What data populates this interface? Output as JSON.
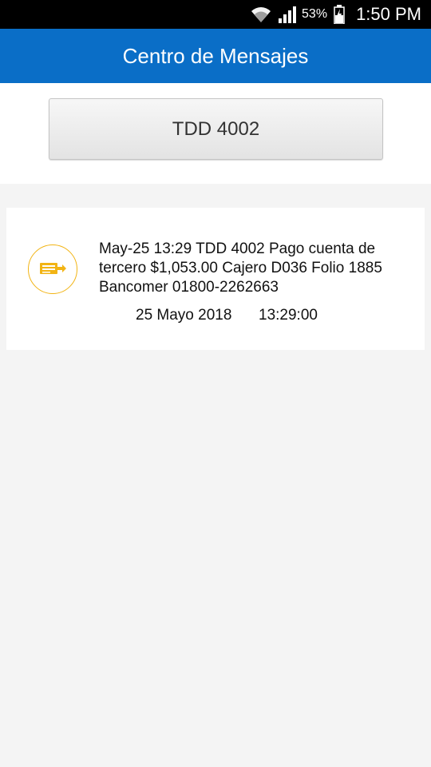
{
  "status_bar": {
    "wifi_icon": "wifi-icon",
    "signal_icon": "signal-icon",
    "battery_percent": "53%",
    "battery_icon": "battery-charging-icon",
    "time": "1:50 PM"
  },
  "header": {
    "title": "Centro de Mensajes"
  },
  "account_selector": {
    "label": "TDD 4002"
  },
  "messages": [
    {
      "icon": "money-transfer-icon",
      "text": "May-25 13:29 TDD 4002 Pago cuenta de tercero $1,053.00 Cajero D036 Folio 1885 Bancomer 01800-2262663",
      "date": "25 Mayo 2018",
      "time": "13:29:00"
    }
  ],
  "colors": {
    "app_bar": "#0a6ec7",
    "icon_accent": "#f2b414",
    "background": "#f4f4f4"
  }
}
